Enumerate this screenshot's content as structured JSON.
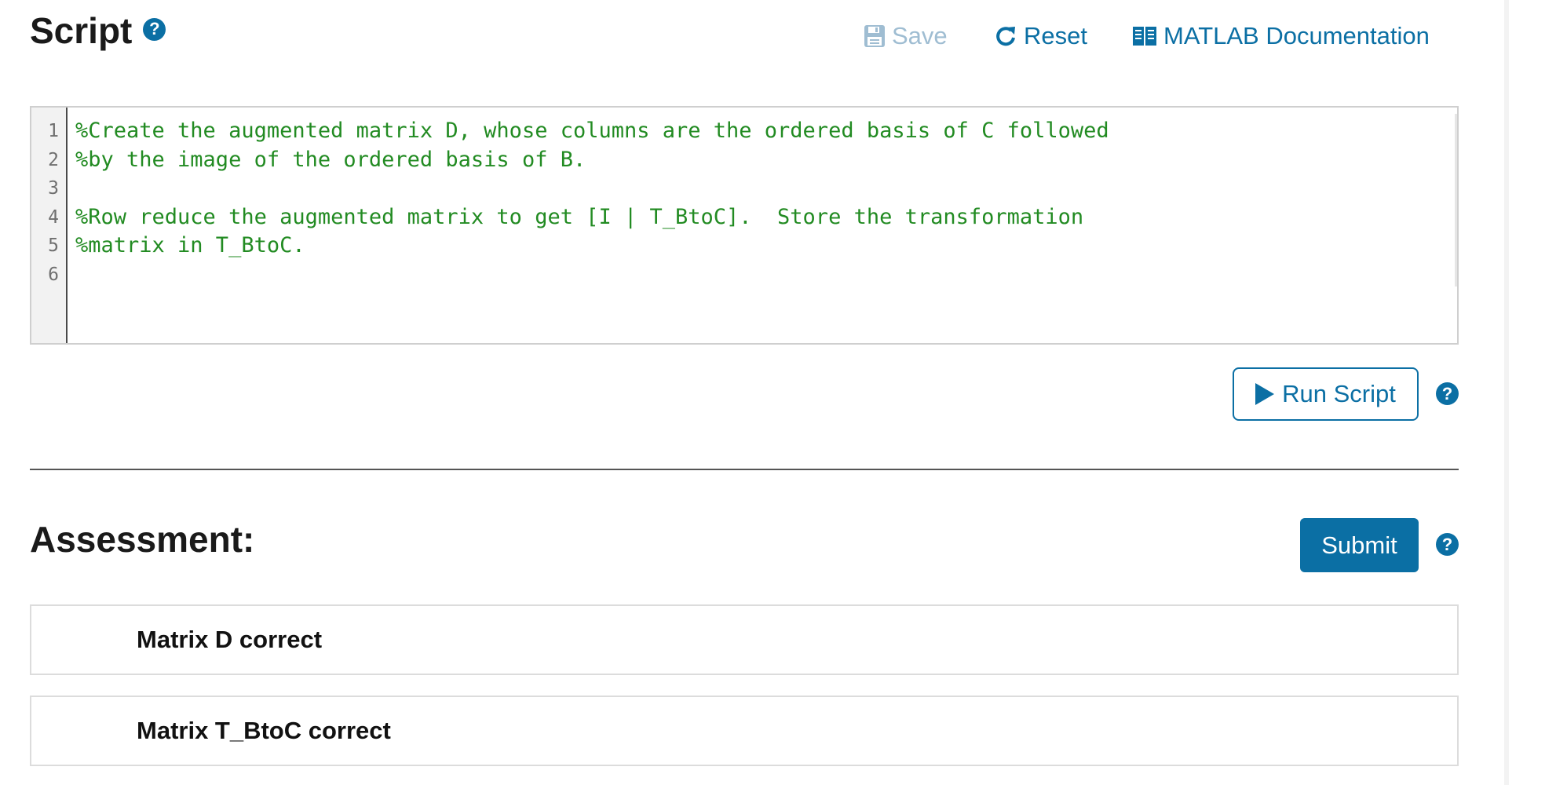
{
  "header": {
    "title": "Script",
    "help_glyph": "?",
    "save_label": "Save",
    "reset_label": "Reset",
    "docs_label": "MATLAB Documentation"
  },
  "editor": {
    "line_numbers": [
      "1",
      "2",
      "3",
      "4",
      "5",
      "6"
    ],
    "lines": [
      "%Create the augmented matrix D, whose columns are the ordered basis of C followed",
      "%by the image of the ordered basis of B.",
      "",
      "%Row reduce the augmented matrix to get [I | T_BtoC].  Store the transformation",
      "%matrix in T_BtoC.",
      ""
    ]
  },
  "run": {
    "label": "Run Script"
  },
  "assessment": {
    "title": "Assessment:",
    "submit_label": "Submit",
    "items": [
      "Matrix D correct",
      "Matrix T_BtoC correct"
    ]
  },
  "colors": {
    "accent": "#0b6fa4",
    "disabled": "#9fbdd2",
    "code_comment": "#228b22"
  },
  "icons": {
    "save": "floppy-disk-icon",
    "reset": "redo-arrow-icon",
    "docs": "open-book-icon",
    "run": "play-icon",
    "help": "question-circle-icon"
  }
}
